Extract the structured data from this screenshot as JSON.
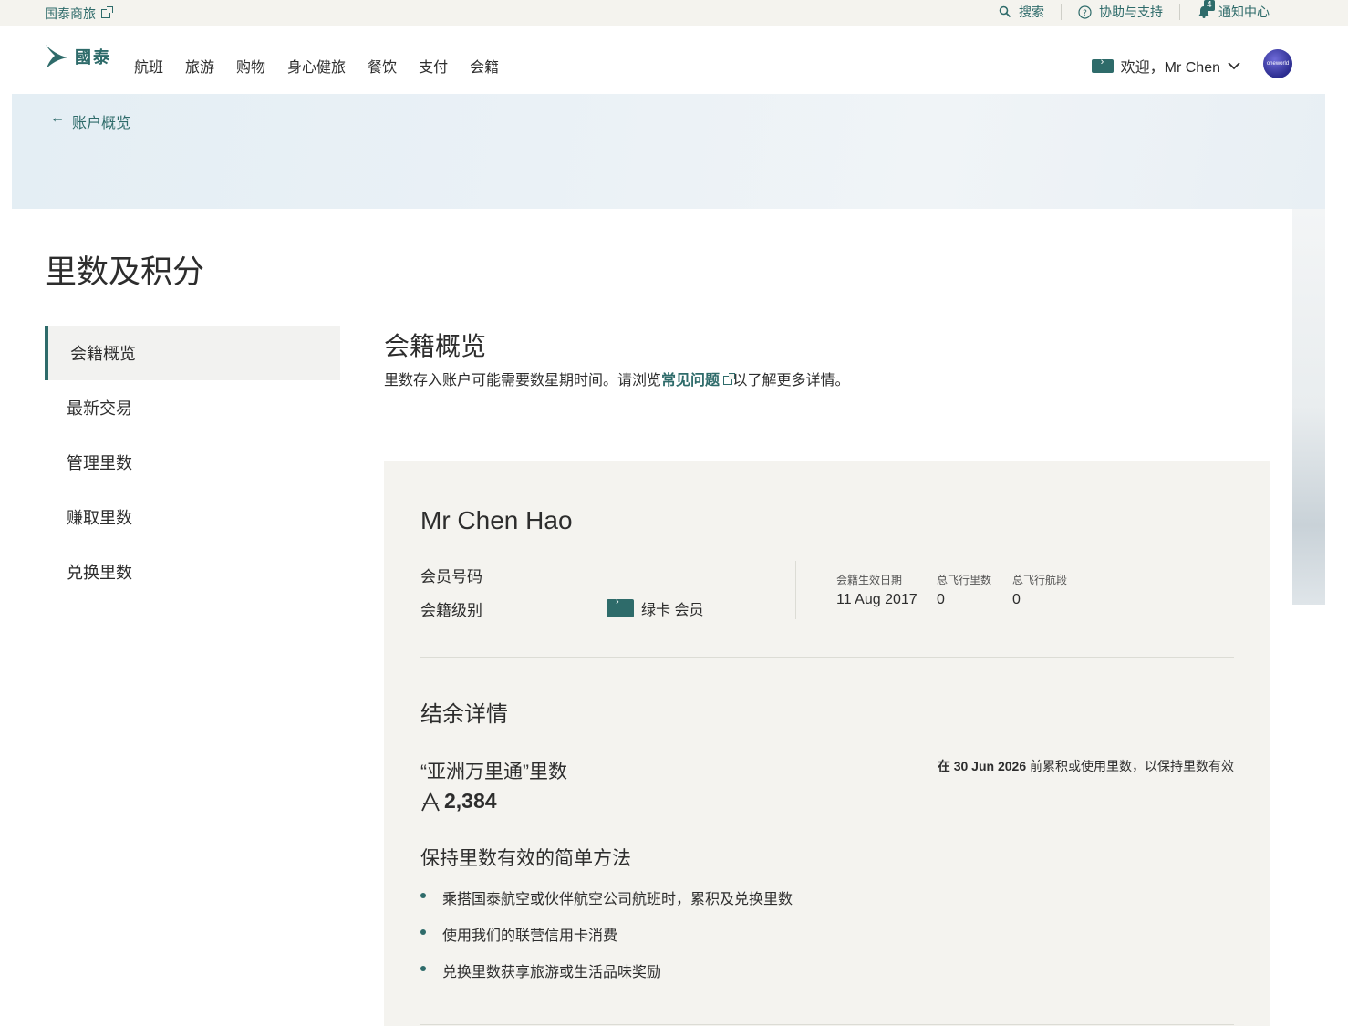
{
  "utility_bar": {
    "business_label": "国泰商旅",
    "search_label": "搜索",
    "help_label": "协助与支持",
    "notification_label": "通知中心",
    "notification_count": "4"
  },
  "nav": {
    "logo_text": "國泰",
    "items": [
      "航班",
      "旅游",
      "购物",
      "身心健旅",
      "餐饮",
      "支付",
      "会籍"
    ],
    "welcome": "欢迎，Mr Chen",
    "oneworld": "oneworld"
  },
  "hero": {
    "back_label": "账户概览"
  },
  "page": {
    "title": "里数及积分"
  },
  "sidebar": {
    "items": [
      {
        "label": "会籍概览"
      },
      {
        "label": "最新交易"
      },
      {
        "label": "管理里数"
      },
      {
        "label": "赚取里数"
      },
      {
        "label": "兑换里数"
      }
    ]
  },
  "overview": {
    "title": "会籍概览",
    "intro_before": "里数存入账户可能需要数星期时间。请浏览",
    "intro_link": "常见问题",
    "intro_after": "以了解更多详情。"
  },
  "member": {
    "name": "Mr Chen Hao",
    "number_label": "会员号码",
    "tier_label": "会籍级别",
    "tier_value": "绿卡 会员",
    "stats": [
      {
        "label": "会籍生效日期",
        "value": "11 Aug 2017"
      },
      {
        "label": "总飞行里数",
        "value": "0"
      },
      {
        "label": "总飞行航段",
        "value": "0"
      }
    ]
  },
  "balance": {
    "title": "结余详情",
    "miles_label": "“亚洲万里通”里数",
    "miles_value": "2,384",
    "expire_prefix": "在",
    "expire_date": "30 Jun 2026",
    "expire_suffix": "前累积或使用里数，以保持里数有效",
    "tips_title": "保持里数有效的简单方法",
    "tips": [
      "乘搭国泰航空或伙伴航空公司航班时，累积及兑换里数",
      "使用我们的联营信用卡消费",
      "兑换里数获享旅游或生活品味奖励"
    ]
  },
  "colors": {
    "accent": "#2e6b6a",
    "panel_bg": "#f4f3ef",
    "utility_bg": "#f4f3ee"
  }
}
